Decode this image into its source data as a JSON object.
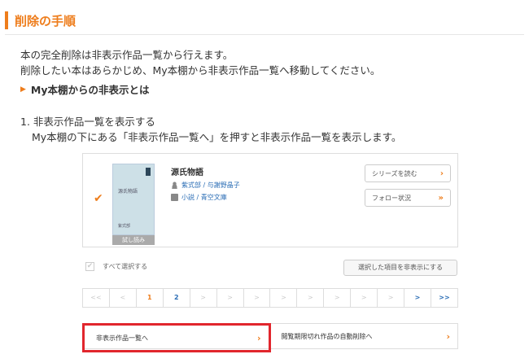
{
  "section": {
    "title": "削除の手順"
  },
  "intro": {
    "line1": "本の完全削除は非表示作品一覧から行えます。",
    "line2": "削除したい本はあらかじめ、My本棚から非表示作品一覧へ移動してください。"
  },
  "hide_link": {
    "label": "My本棚からの非表示とは"
  },
  "step1": {
    "title": "1. 非表示作品一覧を表示する",
    "desc": "My本棚の下にある「非表示作品一覧へ」を押すと非表示作品一覧を表示します。"
  },
  "book": {
    "title": "源氏物語",
    "authors": "紫式部 / 与謝野晶子",
    "category": "小説 / 青空文庫",
    "cover_title": "源氏物語",
    "cover_author": "紫式部",
    "badge": "試し読み"
  },
  "buttons": {
    "series": "シリーズを読む",
    "follow": "フォロー状況",
    "select_all": "すべて選択する",
    "hide_selected": "選択した項目を非表示にする"
  },
  "pager": {
    "items": [
      "<<",
      "<",
      "1",
      "2",
      ">",
      ">",
      ">",
      ">",
      ">",
      ">",
      ">",
      ">",
      ">",
      ">>"
    ]
  },
  "nav": {
    "hidden_list": "非表示作品一覧へ",
    "auto_delete": "閲覧期限切れ作品の自動削除へ"
  },
  "colors": {
    "accent": "#ee7d1c",
    "highlight": "#e1262d",
    "link": "#2a6db5"
  }
}
